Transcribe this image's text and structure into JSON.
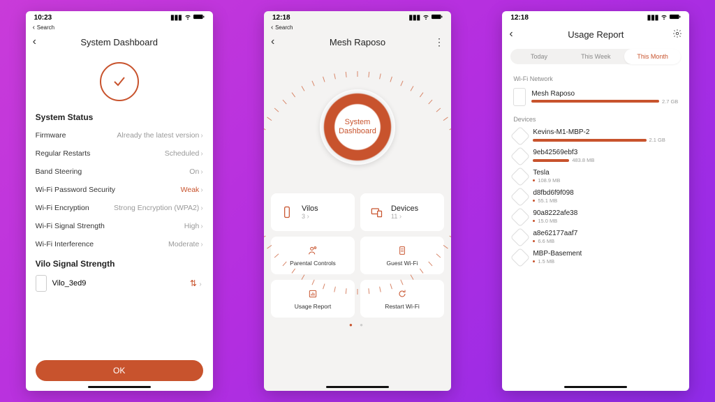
{
  "colors": {
    "accent": "#c8532d"
  },
  "screen1": {
    "time": "10:23",
    "backcrumb": "Search",
    "title": "System Dashboard",
    "status_heading": "System Status",
    "rows": [
      {
        "label": "Firmware",
        "value": "Already the latest version",
        "warn": false
      },
      {
        "label": "Regular Restarts",
        "value": "Scheduled",
        "warn": false
      },
      {
        "label": "Band Steering",
        "value": "On",
        "warn": false
      },
      {
        "label": "Wi-Fi Password Security",
        "value": "Weak",
        "warn": true
      },
      {
        "label": "Wi-Fi Encryption",
        "value": "Strong Encryption (WPA2)",
        "warn": false
      },
      {
        "label": "Wi-Fi Signal Strength",
        "value": "High",
        "warn": false
      },
      {
        "label": "Wi-Fi Interference",
        "value": "Moderate",
        "warn": false
      }
    ],
    "signal_heading": "Vilo Signal Strength",
    "signal_item": "Vilo_3ed9",
    "ok": "OK"
  },
  "screen2": {
    "time": "12:18",
    "backcrumb": "Search",
    "title": "Mesh Raposo",
    "dial_label": "System\nDashboard",
    "cards": {
      "vilos": {
        "title": "Vilos",
        "count": "3"
      },
      "devices": {
        "title": "Devices",
        "count": "11"
      }
    },
    "smallcards": [
      {
        "name": "parental-controls",
        "title": "Parental Controls"
      },
      {
        "name": "guest-wifi",
        "title": "Guest Wi-Fi"
      },
      {
        "name": "usage-report",
        "title": "Usage Report"
      },
      {
        "name": "restart-wifi",
        "title": "Restart Wi-Fi"
      }
    ]
  },
  "screen3": {
    "time": "12:18",
    "title": "Usage Report",
    "tabs": {
      "today": "Today",
      "week": "This Week",
      "month": "This Month",
      "active": "month"
    },
    "network_heading": "Wi-Fi Network",
    "network": {
      "name": "Mesh Raposo",
      "value": "2.7 GB",
      "pct": 90
    },
    "devices_heading": "Devices",
    "devices": [
      {
        "name": "Kevins-M1-MBP-2",
        "value": "2.1 GB",
        "pct": 78
      },
      {
        "name": "9eb42569ebf3",
        "value": "483.8 MB",
        "pct": 25
      },
      {
        "name": "Tesla",
        "value": "108.9 MB",
        "pct": 0
      },
      {
        "name": "d8fbd6f9f098",
        "value": "55.1 MB",
        "pct": 0
      },
      {
        "name": "90a8222afe38",
        "value": "15.0 MB",
        "pct": 0
      },
      {
        "name": "a8e62177aaf7",
        "value": "6.6 MB",
        "pct": 0
      },
      {
        "name": "MBP-Basement",
        "value": "1.5 MB",
        "pct": 0
      }
    ]
  }
}
